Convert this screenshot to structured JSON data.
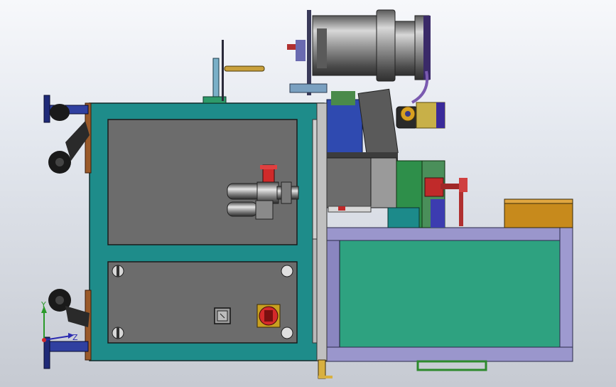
{
  "view": {
    "triad": {
      "y_label": "Y",
      "z_label": "Z"
    }
  },
  "colors": {
    "background_top": "#f7f8fb",
    "background_bottom": "#c6cad2",
    "frame_teal": "#1e8c8a",
    "panel_grey": "#6c6c6c",
    "table_green": "#2ea280",
    "table_frame": "#8a86c0",
    "spindle_grey": "#8c8c8c",
    "caster_navy": "#1f2a78",
    "rod_brass": "#c8a03c",
    "estop_red": "#d42a2a",
    "block_orange": "#c78a1c"
  },
  "components": [
    "main-cabinet",
    "upper-access-panel",
    "lower-control-panel",
    "pneumatic-valve-assembly",
    "emergency-stop-button",
    "power-outlet",
    "caster-wheels",
    "spindle-motor",
    "feed-mechanism",
    "side-worktable",
    "tool-block"
  ]
}
